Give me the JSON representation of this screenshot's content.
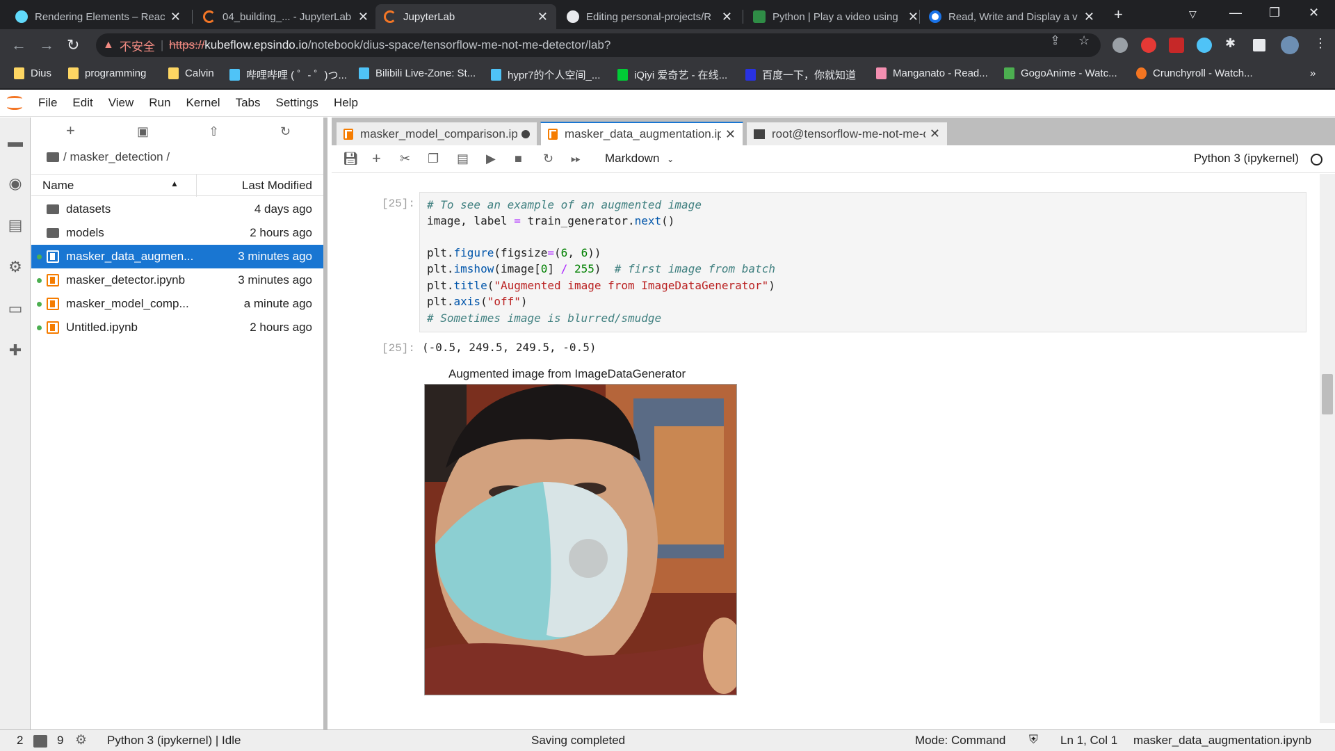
{
  "browser": {
    "tabs": [
      {
        "title": "Rendering Elements – React",
        "active": false
      },
      {
        "title": "04_building_... - JupyterLab",
        "active": false
      },
      {
        "title": "JupyterLab",
        "active": true
      },
      {
        "title": "Editing personal-projects/R",
        "active": false
      },
      {
        "title": "Python | Play a video using",
        "active": false
      },
      {
        "title": "Read, Write and Display a v",
        "active": false
      }
    ],
    "address": {
      "insecure_label": "不安全",
      "scheme": "https://",
      "host": "kubeflow.epsindo.io",
      "path": "/notebook/dius-space/tensorflow-me-not-me-detector/lab?"
    },
    "bookmarks": [
      "Dius",
      "programming",
      "Calvin",
      "哔哩哔哩 ( ゜- ゜)つ...",
      "Bilibili Live-Zone: St...",
      "hypr7的个人空间_...",
      "iQiyi 爱奇艺 - 在线...",
      "百度一下，你就知道",
      "Manganato - Read...",
      "GogoAnime - Watc...",
      "Crunchyroll - Watch..."
    ],
    "bookmark_overflow": "»"
  },
  "menubar": {
    "items": [
      "File",
      "Edit",
      "View",
      "Run",
      "Kernel",
      "Tabs",
      "Settings",
      "Help"
    ]
  },
  "filebrowser": {
    "path": "/ masker_detection /",
    "col_name": "Name",
    "col_modified": "Last Modified",
    "files": [
      {
        "name": "datasets",
        "modified": "4 days ago",
        "type": "folder",
        "running": false,
        "selected": false
      },
      {
        "name": "models",
        "modified": "2 hours ago",
        "type": "folder",
        "running": false,
        "selected": false
      },
      {
        "name": "masker_data_augmen...",
        "modified": "3 minutes ago",
        "type": "notebook",
        "running": true,
        "selected": true
      },
      {
        "name": "masker_detector.ipynb",
        "modified": "3 minutes ago",
        "type": "notebook",
        "running": true,
        "selected": false
      },
      {
        "name": "masker_model_comp...",
        "modified": "a minute ago",
        "type": "notebook",
        "running": true,
        "selected": false
      },
      {
        "name": "Untitled.ipynb",
        "modified": "2 hours ago",
        "type": "notebook",
        "running": true,
        "selected": false
      }
    ]
  },
  "dock_tabs": [
    {
      "label": "masker_model_comparison.ipynb",
      "active": false,
      "dirty": true
    },
    {
      "label": "masker_data_augmentation.ipynb",
      "active": true,
      "dirty": false
    },
    {
      "label": "root@tensorflow-me-not-me-detector",
      "active": false,
      "dirty": false
    }
  ],
  "notebook_toolbar": {
    "cell_type": "Markdown",
    "kernel": "Python 3 (ipykernel)"
  },
  "cell": {
    "in_prompt": "[25]:",
    "out_prompt": "[25]:",
    "lines": [
      "# To see an example of an augmented image",
      "image, label = train_generator.next()",
      "",
      "plt.figure(figsize=(6, 6))",
      "plt.imshow(image[0] / 255)  # first image from batch",
      "plt.title(\"Augmented image from ImageDataGenerator\")",
      "plt.axis(\"off\")",
      "# Sometimes image is blurred/smudge"
    ],
    "output_text": "(-0.5, 249.5, 249.5, -0.5)",
    "figure_title": "Augmented image from ImageDataGenerator"
  },
  "statusbar": {
    "terminals": "2",
    "kernels": "9",
    "kernel_status": "Python 3 (ipykernel) | Idle",
    "saving": "Saving completed",
    "mode": "Mode: Command",
    "position": "Ln 1, Col 1",
    "filename": "masker_data_augmentation.ipynb"
  }
}
